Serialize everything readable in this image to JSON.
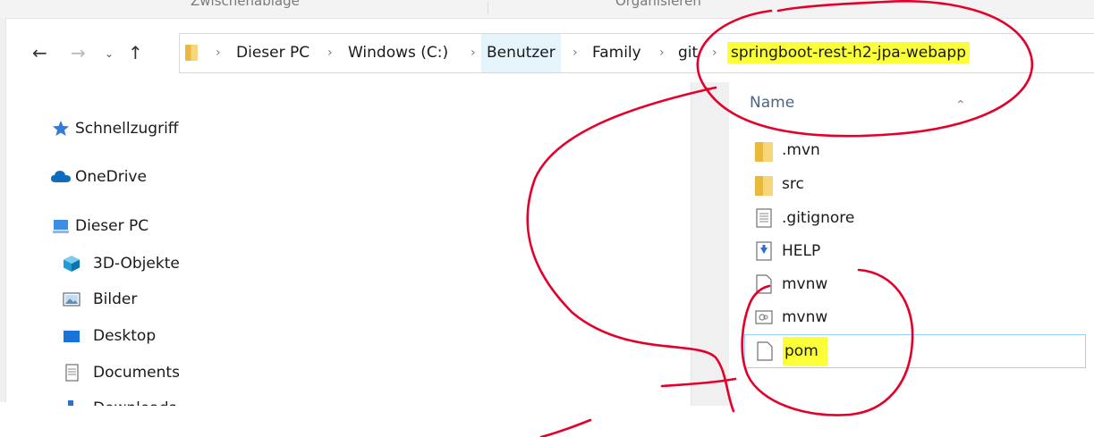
{
  "ribbon": {
    "labels": [
      "Zwischenablage",
      "Organisieren"
    ]
  },
  "nav": {
    "back_icon": "arrow-left-icon",
    "forward_icon": "arrow-right-icon",
    "history_icon": "chevron-down-icon",
    "up_icon": "arrow-up-icon"
  },
  "breadcrumb": [
    {
      "label": "Dieser PC"
    },
    {
      "label": "Windows (C:)"
    },
    {
      "label": "Benutzer"
    },
    {
      "label": "Family"
    },
    {
      "label": "git"
    },
    {
      "label": "springboot-rest-h2-jpa-webapp"
    }
  ],
  "sidebar": {
    "items": [
      {
        "label": "Schnellzugriff",
        "icon": "star-icon"
      },
      {
        "label": "OneDrive",
        "icon": "cloud-icon"
      },
      {
        "label": "Dieser PC",
        "icon": "computer-icon"
      },
      {
        "label": "3D-Objekte",
        "icon": "cube-icon"
      },
      {
        "label": "Bilder",
        "icon": "pictures-icon"
      },
      {
        "label": "Desktop",
        "icon": "desktop-icon"
      },
      {
        "label": "Documents",
        "icon": "document-icon"
      },
      {
        "label": "Downloads",
        "icon": "download-icon"
      }
    ]
  },
  "file_list": {
    "column_name": "Name",
    "files": [
      {
        "name": ".mvn",
        "type": "folder-icon"
      },
      {
        "name": "src",
        "type": "folder-icon"
      },
      {
        "name": ".gitignore",
        "type": "text-file-icon"
      },
      {
        "name": "HELP",
        "type": "markdown-file-icon"
      },
      {
        "name": "mvnw",
        "type": "blank-file-icon"
      },
      {
        "name": "mvnw",
        "type": "batch-file-icon"
      },
      {
        "name": "pom",
        "type": "blank-file-icon"
      }
    ]
  },
  "colors": {
    "highlight": "#fbff3a",
    "annotation": "#e4002b",
    "selection_border": "#99d1ff"
  }
}
